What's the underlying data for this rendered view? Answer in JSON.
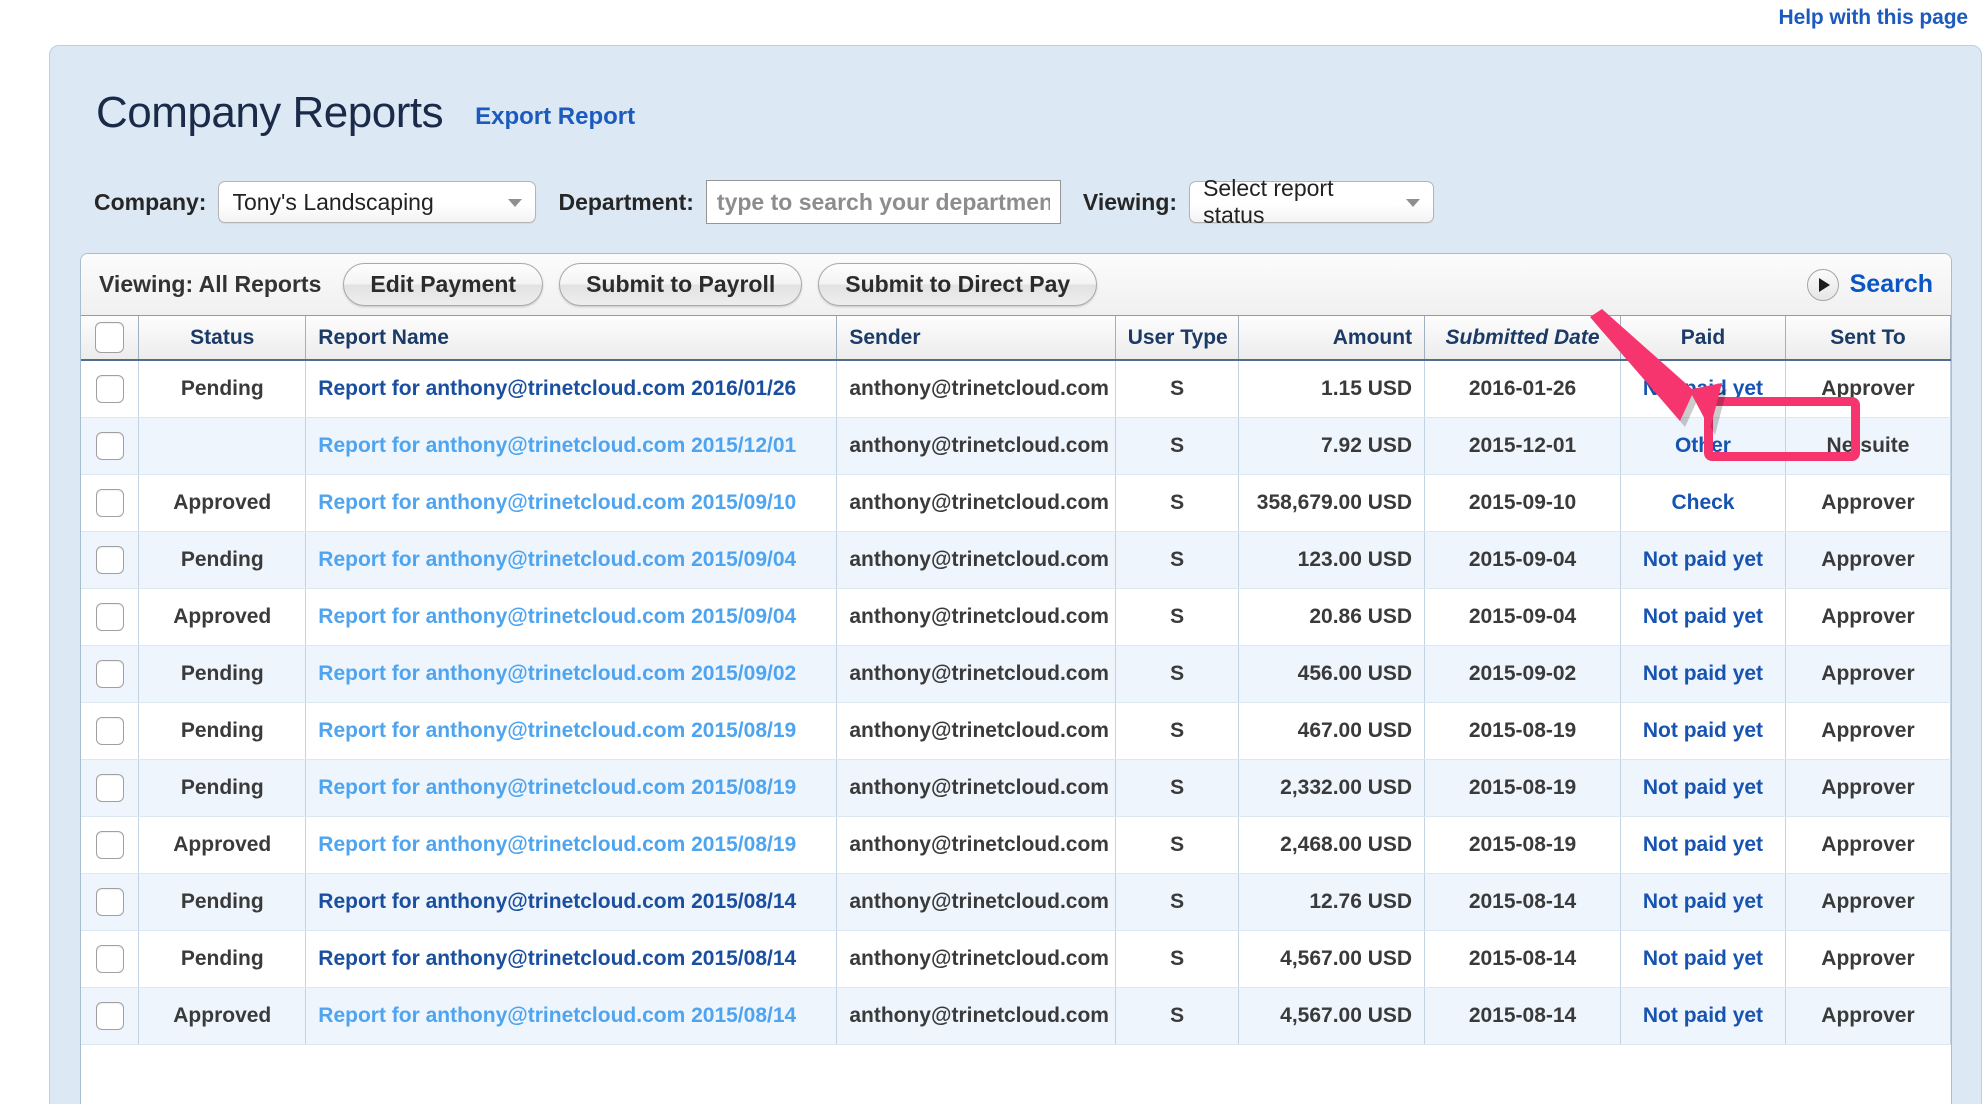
{
  "help": {
    "label": "Help with this page"
  },
  "header": {
    "title": "Company Reports",
    "export_label": "Export Report"
  },
  "filters": {
    "company_label": "Company:",
    "company_value": "Tony's Landscaping",
    "department_label": "Department:",
    "department_value": "",
    "department_placeholder": "type to search your department",
    "viewing_label": "Viewing:",
    "viewing_value": "Select report status"
  },
  "toolbar": {
    "viewing_text": "Viewing: All Reports",
    "edit_payment_label": "Edit Payment",
    "submit_payroll_label": "Submit to Payroll",
    "submit_direct_pay_label": "Submit to Direct Pay",
    "search_label": "Search"
  },
  "table": {
    "columns": [
      {
        "key": "check",
        "label": ""
      },
      {
        "key": "status",
        "label": "Status"
      },
      {
        "key": "name",
        "label": "Report Name"
      },
      {
        "key": "sender",
        "label": "Sender"
      },
      {
        "key": "utype",
        "label": "User Type"
      },
      {
        "key": "amount",
        "label": "Amount"
      },
      {
        "key": "date",
        "label": "Submitted Date"
      },
      {
        "key": "paid",
        "label": "Paid"
      },
      {
        "key": "sent",
        "label": "Sent To"
      }
    ],
    "sorted_column": "Submitted Date",
    "rows": [
      {
        "status": "Pending",
        "name": "Report for anthony@trinetcloud.com 2016/01/26",
        "name_style": "dark",
        "sender": "anthony@trinetcloud.com",
        "utype": "S",
        "amount": "1.15 USD",
        "date": "2016-01-26",
        "paid": "Not paid yet",
        "sent": "Approver"
      },
      {
        "status": "",
        "name": "Report for anthony@trinetcloud.com 2015/12/01",
        "name_style": "light",
        "sender": "anthony@trinetcloud.com",
        "utype": "S",
        "amount": "7.92 USD",
        "date": "2015-12-01",
        "paid": "Other",
        "sent": "Netsuite"
      },
      {
        "status": "Approved",
        "name": "Report for anthony@trinetcloud.com 2015/09/10",
        "name_style": "light",
        "sender": "anthony@trinetcloud.com",
        "utype": "S",
        "amount": "358,679.00 USD",
        "date": "2015-09-10",
        "paid": "Check",
        "sent": "Approver"
      },
      {
        "status": "Pending",
        "name": "Report for anthony@trinetcloud.com 2015/09/04",
        "name_style": "light",
        "sender": "anthony@trinetcloud.com",
        "utype": "S",
        "amount": "123.00 USD",
        "date": "2015-09-04",
        "paid": "Not paid yet",
        "sent": "Approver"
      },
      {
        "status": "Approved",
        "name": "Report for anthony@trinetcloud.com 2015/09/04",
        "name_style": "light",
        "sender": "anthony@trinetcloud.com",
        "utype": "S",
        "amount": "20.86 USD",
        "date": "2015-09-04",
        "paid": "Not paid yet",
        "sent": "Approver"
      },
      {
        "status": "Pending",
        "name": "Report for anthony@trinetcloud.com 2015/09/02",
        "name_style": "light",
        "sender": "anthony@trinetcloud.com",
        "utype": "S",
        "amount": "456.00 USD",
        "date": "2015-09-02",
        "paid": "Not paid yet",
        "sent": "Approver"
      },
      {
        "status": "Pending",
        "name": "Report for anthony@trinetcloud.com 2015/08/19",
        "name_style": "light",
        "sender": "anthony@trinetcloud.com",
        "utype": "S",
        "amount": "467.00 USD",
        "date": "2015-08-19",
        "paid": "Not paid yet",
        "sent": "Approver"
      },
      {
        "status": "Pending",
        "name": "Report for anthony@trinetcloud.com 2015/08/19",
        "name_style": "light",
        "sender": "anthony@trinetcloud.com",
        "utype": "S",
        "amount": "2,332.00 USD",
        "date": "2015-08-19",
        "paid": "Not paid yet",
        "sent": "Approver"
      },
      {
        "status": "Approved",
        "name": "Report for anthony@trinetcloud.com 2015/08/19",
        "name_style": "light",
        "sender": "anthony@trinetcloud.com",
        "utype": "S",
        "amount": "2,468.00 USD",
        "date": "2015-08-19",
        "paid": "Not paid yet",
        "sent": "Approver"
      },
      {
        "status": "Pending",
        "name": "Report for anthony@trinetcloud.com 2015/08/14",
        "name_style": "dark",
        "sender": "anthony@trinetcloud.com",
        "utype": "S",
        "amount": "12.76 USD",
        "date": "2015-08-14",
        "paid": "Not paid yet",
        "sent": "Approver"
      },
      {
        "status": "Pending",
        "name": "Report for anthony@trinetcloud.com 2015/08/14",
        "name_style": "dark",
        "sender": "anthony@trinetcloud.com",
        "utype": "S",
        "amount": "4,567.00 USD",
        "date": "2015-08-14",
        "paid": "Not paid yet",
        "sent": "Approver"
      },
      {
        "status": "Approved",
        "name": "Report for anthony@trinetcloud.com 2015/08/14",
        "name_style": "light",
        "sender": "anthony@trinetcloud.com",
        "utype": "S",
        "amount": "4,567.00 USD",
        "date": "2015-08-14",
        "paid": "Not paid yet",
        "sent": "Approver"
      }
    ]
  },
  "annotation": {
    "color": "#f6356f",
    "target": "Not paid yet"
  }
}
